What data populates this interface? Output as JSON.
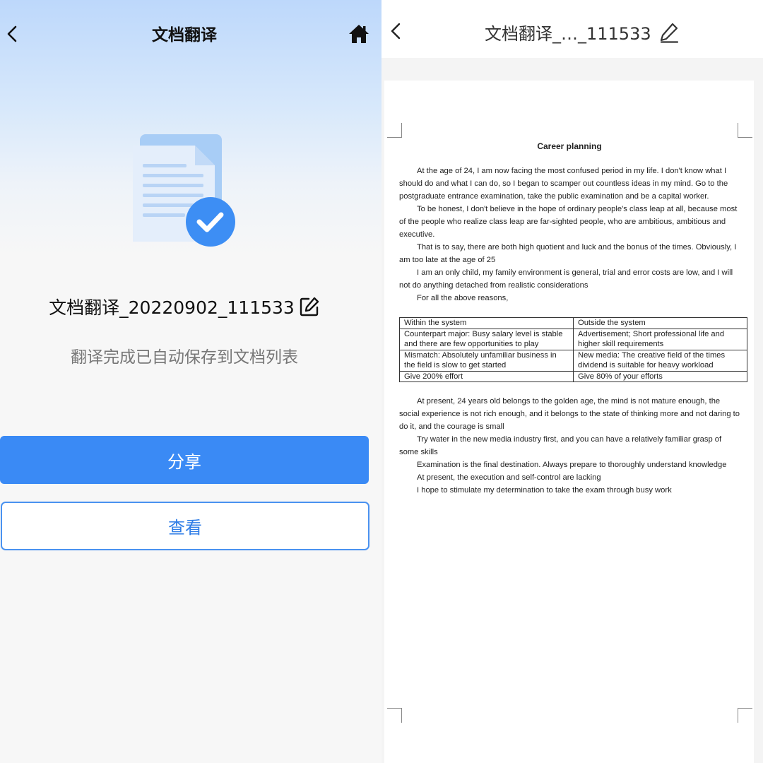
{
  "left": {
    "title": "文档翻译",
    "file_name": "文档翻译_20220902_111533",
    "status": "翻译完成已自动保存到文档列表",
    "share_label": "分享",
    "view_label": "查看",
    "accent": "#3a8af5"
  },
  "right": {
    "title": "文档翻译_…_111533",
    "document": {
      "heading": "Career planning",
      "paragraphs_before": [
        "At the age of 24, I am now facing the most confused period in my life. I don't know what I should do and what I can do, so I began to scamper out countless ideas in my mind. Go to the postgraduate entrance examination, take the public examination and be a capital worker.",
        "To be honest, I don't believe in the hope of ordinary people's class leap at all, because most of the people who realize class leap are far-sighted people, who are ambitious, ambitious and executive.",
        "That is to say, there are both high quotient and luck and the bonus of the times. Obviously, I am too late at the age of 25",
        "I am an only child, my family environment is general, trial and error costs are low, and I will not do anything detached from realistic considerations",
        "For all the above reasons,"
      ],
      "table": [
        [
          "Within the system",
          "Outside the system"
        ],
        [
          "Counterpart major: Busy salary level is stable and there are few opportunities to play",
          "Advertisement; Short professional life and higher skill requirements"
        ],
        [
          "Mismatch: Absolutely unfamiliar business in the field is slow to get started",
          "New media: The creative field of the times dividend is suitable for heavy workload"
        ],
        [
          "Give 200% effort",
          "Give 80% of your efforts"
        ]
      ],
      "paragraphs_after": [
        "At present, 24 years old belongs to the golden age, the mind is not mature enough, the social experience is not rich enough, and it belongs to the state of thinking more and not daring to do it, and the courage is small",
        "Try water in the new media industry first, and you can have a relatively familiar grasp of some skills",
        "Examination is the final destination. Always prepare to thoroughly understand knowledge",
        "At present, the execution and self-control are lacking",
        "I hope to stimulate my determination to take the exam through busy work"
      ]
    }
  }
}
